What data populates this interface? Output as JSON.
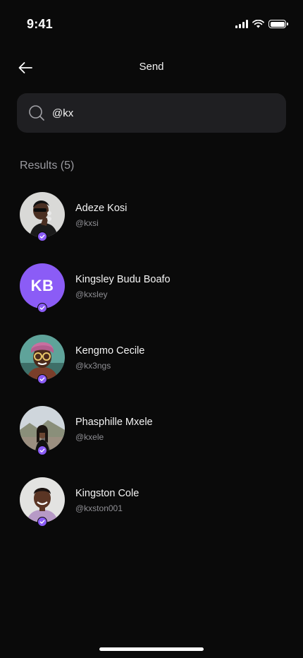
{
  "status_bar": {
    "time": "9:41",
    "icons": [
      "cellular-signal-icon",
      "wifi-icon",
      "battery-icon"
    ]
  },
  "header": {
    "title": "Send",
    "back_icon": "arrow-left-icon"
  },
  "search": {
    "value": "@kx",
    "icon": "search-icon"
  },
  "results": {
    "label": "Results (5)",
    "items": [
      {
        "name": "Adeze Kosi",
        "handle": "@kxsi",
        "avatar": "photo",
        "verified": true
      },
      {
        "name": "Kingsley Budu Boafo",
        "handle": "@kxsley",
        "avatar": "initials",
        "initials": "KB",
        "avatar_color": "#8b5cf6",
        "verified": true
      },
      {
        "name": "Kengmo Cecile",
        "handle": "@kx3ngs",
        "avatar": "photo",
        "verified": true
      },
      {
        "name": "Phasphille Mxele",
        "handle": "@kxele",
        "avatar": "photo",
        "verified": true
      },
      {
        "name": "Kingston Cole",
        "handle": "@kxston001",
        "avatar": "photo",
        "verified": true
      }
    ]
  },
  "colors": {
    "background": "#0a0a0a",
    "search_background": "#1f1f22",
    "accent": "#8b5cf6",
    "secondary_text": "#8e8e93"
  }
}
